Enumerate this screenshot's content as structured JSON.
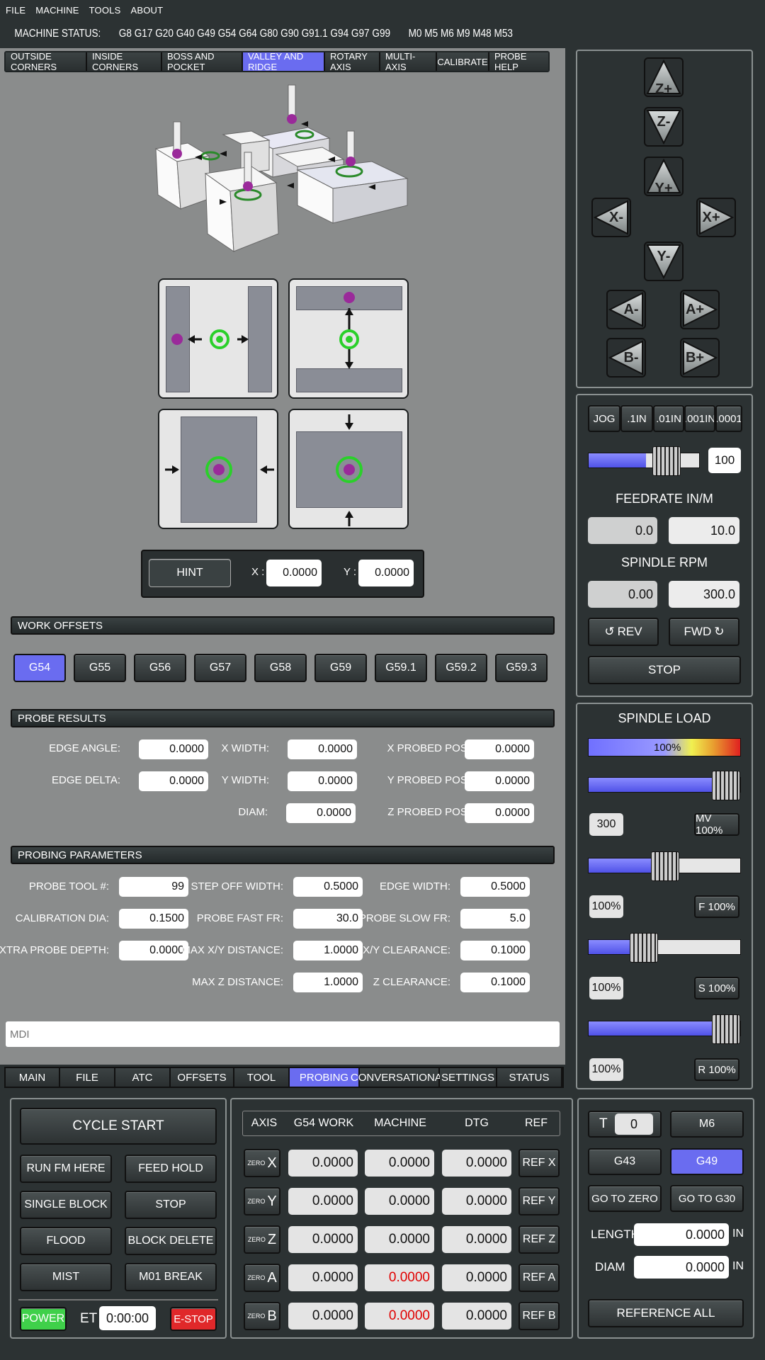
{
  "menu": {
    "file": "FILE",
    "machine": "MACHINE",
    "tools": "TOOLS",
    "about": "ABOUT"
  },
  "status": {
    "label": "MACHINE STATUS:",
    "gcodes": "G8 G17 G20 G40 G49 G54 G64 G80 G90 G91.1 G94 G97 G99",
    "mcodes": "M0 M5 M6 M9 M48 M53"
  },
  "probe_tabs": [
    "OUTSIDE CORNERS",
    "INSIDE CORNERS",
    "BOSS AND POCKET",
    "VALLEY AND RIDGE",
    "ROTARY AXIS",
    "MULTI-AXIS",
    "CALIBRATE",
    "PROBE HELP"
  ],
  "hint": {
    "button": "HINT",
    "x_label": "X :",
    "x_value": "0.0000",
    "y_label": "Y :",
    "y_value": "0.0000"
  },
  "work_offsets": {
    "title": "WORK OFFSETS",
    "items": [
      "G54",
      "G55",
      "G56",
      "G57",
      "G58",
      "G59",
      "G59.1",
      "G59.2",
      "G59.3"
    ]
  },
  "probe_results": {
    "title": "PROBE RESULTS",
    "edge_angle": "EDGE ANGLE:",
    "edge_angle_v": "0.0000",
    "x_width": "X WIDTH:",
    "x_width_v": "0.0000",
    "x_probed": "X PROBED POS:",
    "x_probed_v": "0.0000",
    "edge_delta": "EDGE DELTA:",
    "edge_delta_v": "0.0000",
    "y_width": "Y WIDTH:",
    "y_width_v": "0.0000",
    "y_probed": "Y PROBED POS:",
    "y_probed_v": "0.0000",
    "diam": "DIAM:",
    "diam_v": "0.0000",
    "z_probed": "Z PROBED POS:",
    "z_probed_v": "0.0000"
  },
  "probing_params": {
    "title": "PROBING PARAMETERS",
    "tool": "PROBE TOOL #:",
    "tool_v": "99",
    "step_off": "STEP OFF WIDTH:",
    "step_off_v": "0.5000",
    "edge_width": "EDGE WIDTH:",
    "edge_width_v": "0.5000",
    "cal_dia": "CALIBRATION DIA:",
    "cal_dia_v": "0.1500",
    "fast_fr": "PROBE FAST FR:",
    "fast_fr_v": "30.0",
    "slow_fr": "PROBE SLOW FR:",
    "slow_fr_v": "5.0",
    "extra": "EXTRA PROBE DEPTH:",
    "extra_v": "0.0000",
    "max_xy": "MAX X/Y DISTANCE:",
    "max_xy_v": "1.0000",
    "xy_clear": "X/Y CLEARANCE:",
    "xy_clear_v": "0.1000",
    "max_z": "MAX Z DISTANCE:",
    "max_z_v": "1.0000",
    "z_clear": "Z CLEARANCE:",
    "z_clear_v": "0.1000"
  },
  "mdi": {
    "placeholder": "MDI"
  },
  "bottom_tabs": [
    "MAIN",
    "FILE",
    "ATC",
    "OFFSETS",
    "TOOL",
    "PROBING",
    "CONVERSATIONAL",
    "SETTINGS",
    "STATUS"
  ],
  "jog": {
    "zp": "Z+",
    "zm": "Z-",
    "yp": "Y+",
    "ym": "Y-",
    "xm": "X-",
    "xp": "X+",
    "am": "A-",
    "ap": "A+",
    "bm": "B-",
    "bp": "B+"
  },
  "jog_increments": [
    "JOG",
    ".1IN",
    ".01IN",
    ".001IN",
    ".0001"
  ],
  "jog_rate": {
    "value": "100",
    "fill": 0.5
  },
  "feedrate": {
    "title": "FEEDRATE IN/M",
    "actual": "0.0",
    "set": "10.0"
  },
  "spindle": {
    "title": "SPINDLE RPM",
    "actual": "0.00",
    "set": "300.0",
    "rev": "REV",
    "fwd": "FWD",
    "stop": "STOP"
  },
  "spindle_load": {
    "title": "SPINDLE LOAD",
    "bar_label": "100%",
    "max_velocity": "300",
    "mv_button": "MV 100%",
    "feed_pct": "100%",
    "f_button": "F 100%",
    "spindle_pct": "100%",
    "s_button": "S 100%",
    "rapid_pct": "100%",
    "r_button": "R 100%"
  },
  "controls": {
    "cycle_start": "CYCLE START",
    "run_from_here": "RUN FM HERE",
    "feed_hold": "FEED HOLD",
    "single_block": "SINGLE BLOCK",
    "stop": "STOP",
    "flood": "FLOOD",
    "block_delete": "BLOCK DELETE",
    "mist": "MIST",
    "m01_break": "M01 BREAK",
    "power": "POWER",
    "et_label": "ET",
    "et_value": "0:00:00",
    "estop": "E-STOP"
  },
  "dro": {
    "headers": [
      "AXIS",
      "G54 WORK",
      "MACHINE",
      "DTG",
      "REF"
    ],
    "zero_label": "ZERO",
    "rows": [
      {
        "axis": "X",
        "work": "0.0000",
        "machine": "0.0000",
        "dtg": "0.0000",
        "ref": "REF X"
      },
      {
        "axis": "Y",
        "work": "0.0000",
        "machine": "0.0000",
        "dtg": "0.0000",
        "ref": "REF Y"
      },
      {
        "axis": "Z",
        "work": "0.0000",
        "machine": "0.0000",
        "dtg": "0.0000",
        "ref": "REF Z"
      },
      {
        "axis": "A",
        "work": "0.0000",
        "machine": "0.0000",
        "dtg": "0.0000",
        "ref": "REF A"
      },
      {
        "axis": "B",
        "work": "0.0000",
        "machine": "0.0000",
        "dtg": "0.0000",
        "ref": "REF B"
      }
    ]
  },
  "tool": {
    "t_label": "T",
    "t_value": "0",
    "m6": "M6",
    "g43": "G43",
    "g49": "G49",
    "go_zero": "GO TO ZERO",
    "go_g30": "GO TO G30",
    "length_label": "LENGTH",
    "length_value": "0.0000",
    "diam_label": "DIAM",
    "diam_value": "0.0000",
    "unit": "IN",
    "ref_all": "REFERENCE ALL"
  },
  "colors": {
    "accent": "#6a6cf0",
    "power": "#3fd04a",
    "estop": "#e0282a"
  }
}
